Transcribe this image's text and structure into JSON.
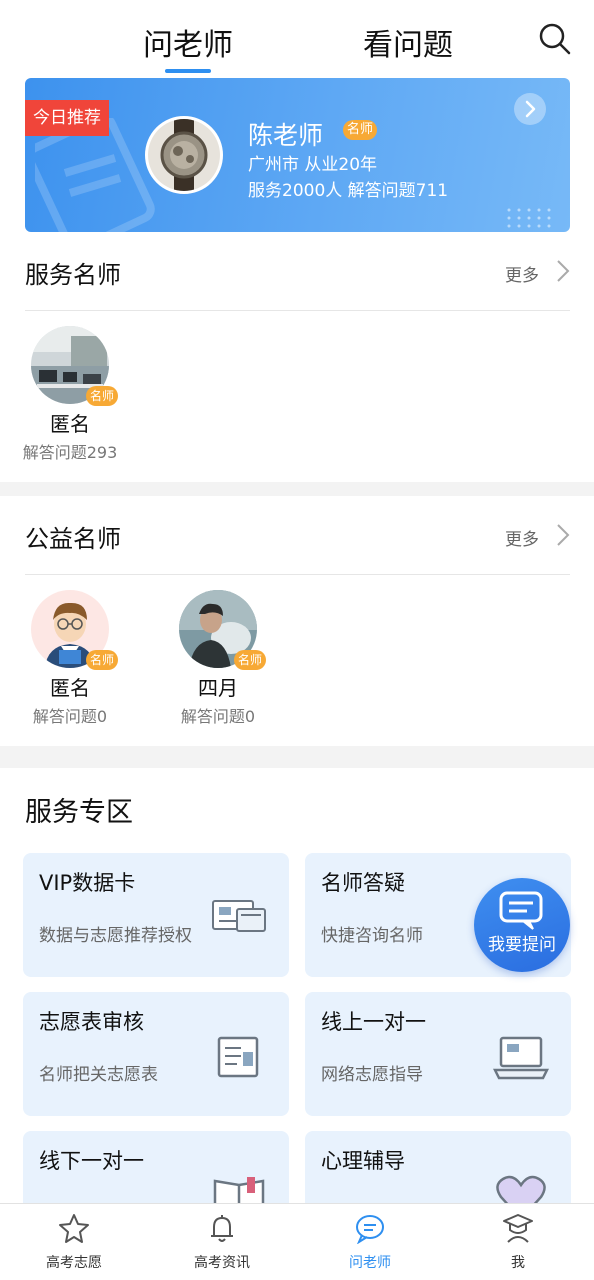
{
  "topnav": {
    "tab_ask": "问老师",
    "tab_view": "看问题",
    "search_icon": "search-icon"
  },
  "banner": {
    "badge": "今日推荐",
    "name": "陈老师",
    "tag": "名师",
    "line1": "广州市 从业20年",
    "line2": "服务2000人 解答问题711"
  },
  "service_teachers": {
    "title": "服务名师",
    "more": "更多",
    "items": [
      {
        "name": "匿名",
        "tag": "名师",
        "sub": "解答问题293"
      }
    ]
  },
  "charity_teachers": {
    "title": "公益名师",
    "more": "更多",
    "items": [
      {
        "name": "匿名",
        "tag": "名师",
        "sub": "解答问题0"
      },
      {
        "name": "四月",
        "tag": "名师",
        "sub": "解答问题0"
      }
    ]
  },
  "service_zone": {
    "title": "服务专区",
    "cards": [
      {
        "title": "VIP数据卡",
        "sub": "数据与志愿推荐授权",
        "icon": "card-icon"
      },
      {
        "title": "名师答疑",
        "sub": "快捷咨询名师",
        "icon": "chat-icon"
      },
      {
        "title": "志愿表审核",
        "sub": "名师把关志愿表",
        "icon": "document-icon"
      },
      {
        "title": "线上一对一",
        "sub": "网络志愿指导",
        "icon": "laptop-icon"
      },
      {
        "title": "线下一对一",
        "sub": "",
        "icon": "book-icon"
      },
      {
        "title": "心理辅导",
        "sub": "",
        "icon": "heart-icon"
      }
    ],
    "ask_button": "我要提问"
  },
  "bottombar": {
    "items": [
      {
        "label": "高考志愿",
        "icon": "star-icon"
      },
      {
        "label": "高考资讯",
        "icon": "bell-icon"
      },
      {
        "label": "问老师",
        "icon": "chat-bubble-icon"
      },
      {
        "label": "我",
        "icon": "graduate-icon"
      }
    ],
    "active_color": "#2e8ff0"
  }
}
